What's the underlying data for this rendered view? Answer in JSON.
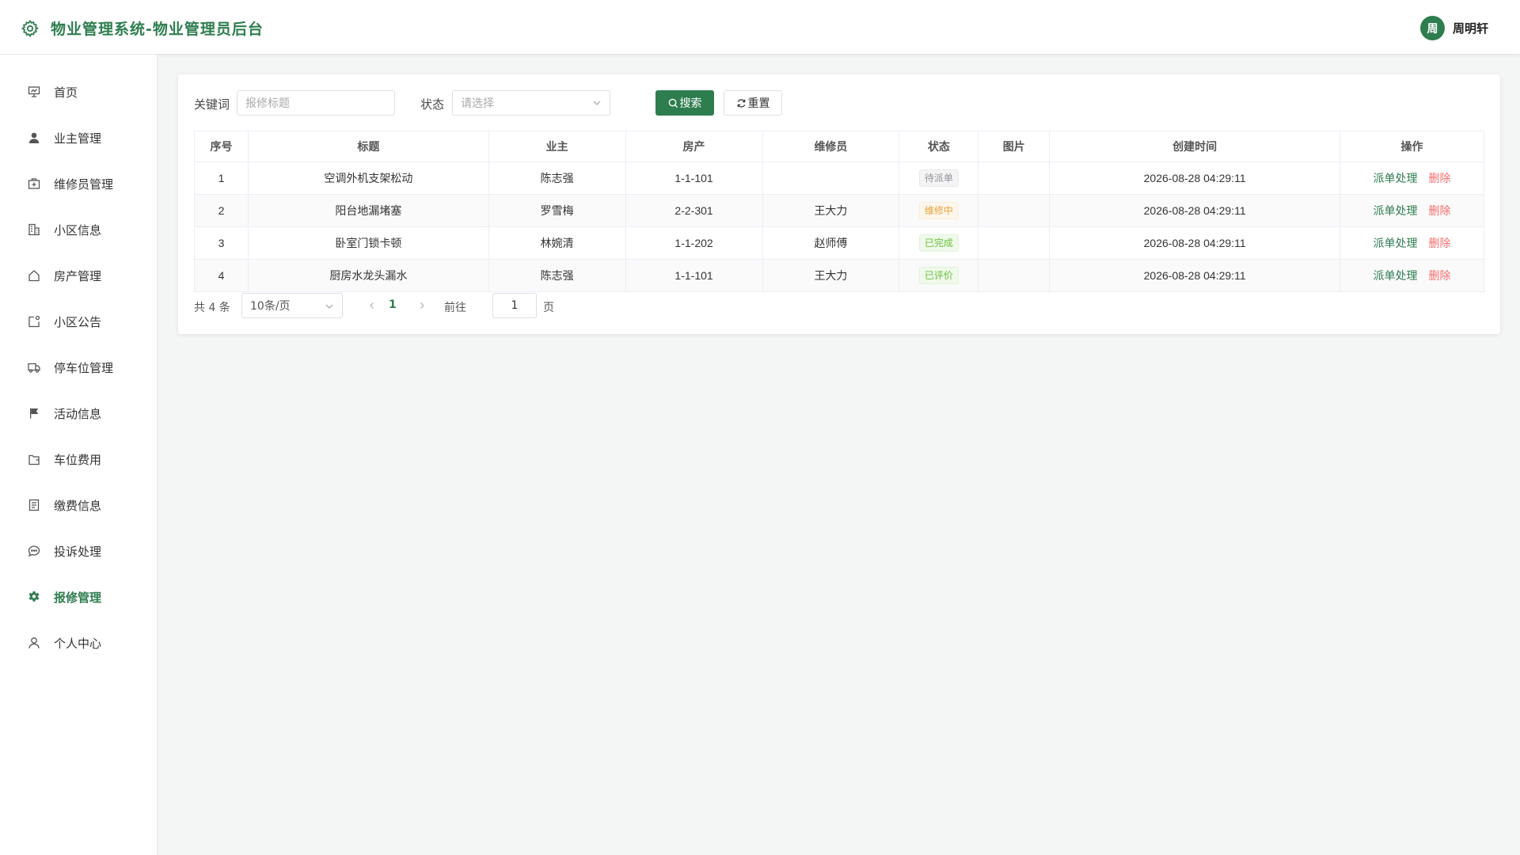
{
  "header": {
    "title": "物业管理系统-物业管理员后台",
    "avatar_text": "周",
    "username": "周明轩"
  },
  "sidebar": {
    "items": [
      {
        "label": "首页",
        "icon": "presentation-board-icon"
      },
      {
        "label": "业主管理",
        "icon": "user-filled-icon"
      },
      {
        "label": "维修员管理",
        "icon": "first-aid-kit-icon"
      },
      {
        "label": "小区信息",
        "icon": "office-building-icon"
      },
      {
        "label": "房产管理",
        "icon": "house-icon"
      },
      {
        "label": "小区公告",
        "icon": "notification-icon"
      },
      {
        "label": "停车位管理",
        "icon": "van-icon"
      },
      {
        "label": "活动信息",
        "icon": "flag-icon"
      },
      {
        "label": "车位费用",
        "icon": "wallet-icon"
      },
      {
        "label": "缴费信息",
        "icon": "document-icon"
      },
      {
        "label": "投诉处理",
        "icon": "chat-dots-icon"
      },
      {
        "label": "报修管理",
        "icon": "setting-icon",
        "active": true
      },
      {
        "label": "个人中心",
        "icon": "user-icon"
      }
    ]
  },
  "filters": {
    "keyword_label": "关键词",
    "keyword_placeholder": "报修标题",
    "status_label": "状态",
    "status_placeholder": "请选择",
    "search_button": "搜索",
    "reset_button": "重置"
  },
  "table": {
    "columns": [
      "序号",
      "标题",
      "业主",
      "房产",
      "维修员",
      "状态",
      "图片",
      "创建时间",
      "操作"
    ],
    "rows": [
      {
        "index": "1",
        "title": "空调外机支架松动",
        "owner": "陈志强",
        "property": "1-1-101",
        "repairer": "",
        "status": "待派单",
        "status_type": "pending",
        "image": "",
        "created": "2026-08-28 04:29:11"
      },
      {
        "index": "2",
        "title": "阳台地漏堵塞",
        "owner": "罗雪梅",
        "property": "2-2-301",
        "repairer": "王大力",
        "status": "维修中",
        "status_type": "repairing",
        "image": "",
        "created": "2026-08-28 04:29:11"
      },
      {
        "index": "3",
        "title": "卧室门锁卡顿",
        "owner": "林婉清",
        "property": "1-1-202",
        "repairer": "赵师傅",
        "status": "已完成",
        "status_type": "done",
        "image": "",
        "created": "2026-08-28 04:29:11"
      },
      {
        "index": "4",
        "title": "厨房水龙头漏水",
        "owner": "陈志强",
        "property": "1-1-101",
        "repairer": "王大力",
        "status": "已评价",
        "status_type": "rated",
        "image": "",
        "created": "2026-08-28 04:29:11"
      }
    ],
    "actions": {
      "dispatch": "派单处理",
      "delete": "删除"
    }
  },
  "pagination": {
    "total_text": "共 4 条",
    "page_size": "10条/页",
    "current_page": "1",
    "goto_label": "前往",
    "goto_value": "1",
    "page_unit": "页"
  },
  "colors": {
    "brand": "#2e7d4f",
    "danger": "#f56c6c",
    "warning": "#e6a23c",
    "success": "#67c23a",
    "info": "#909399"
  }
}
